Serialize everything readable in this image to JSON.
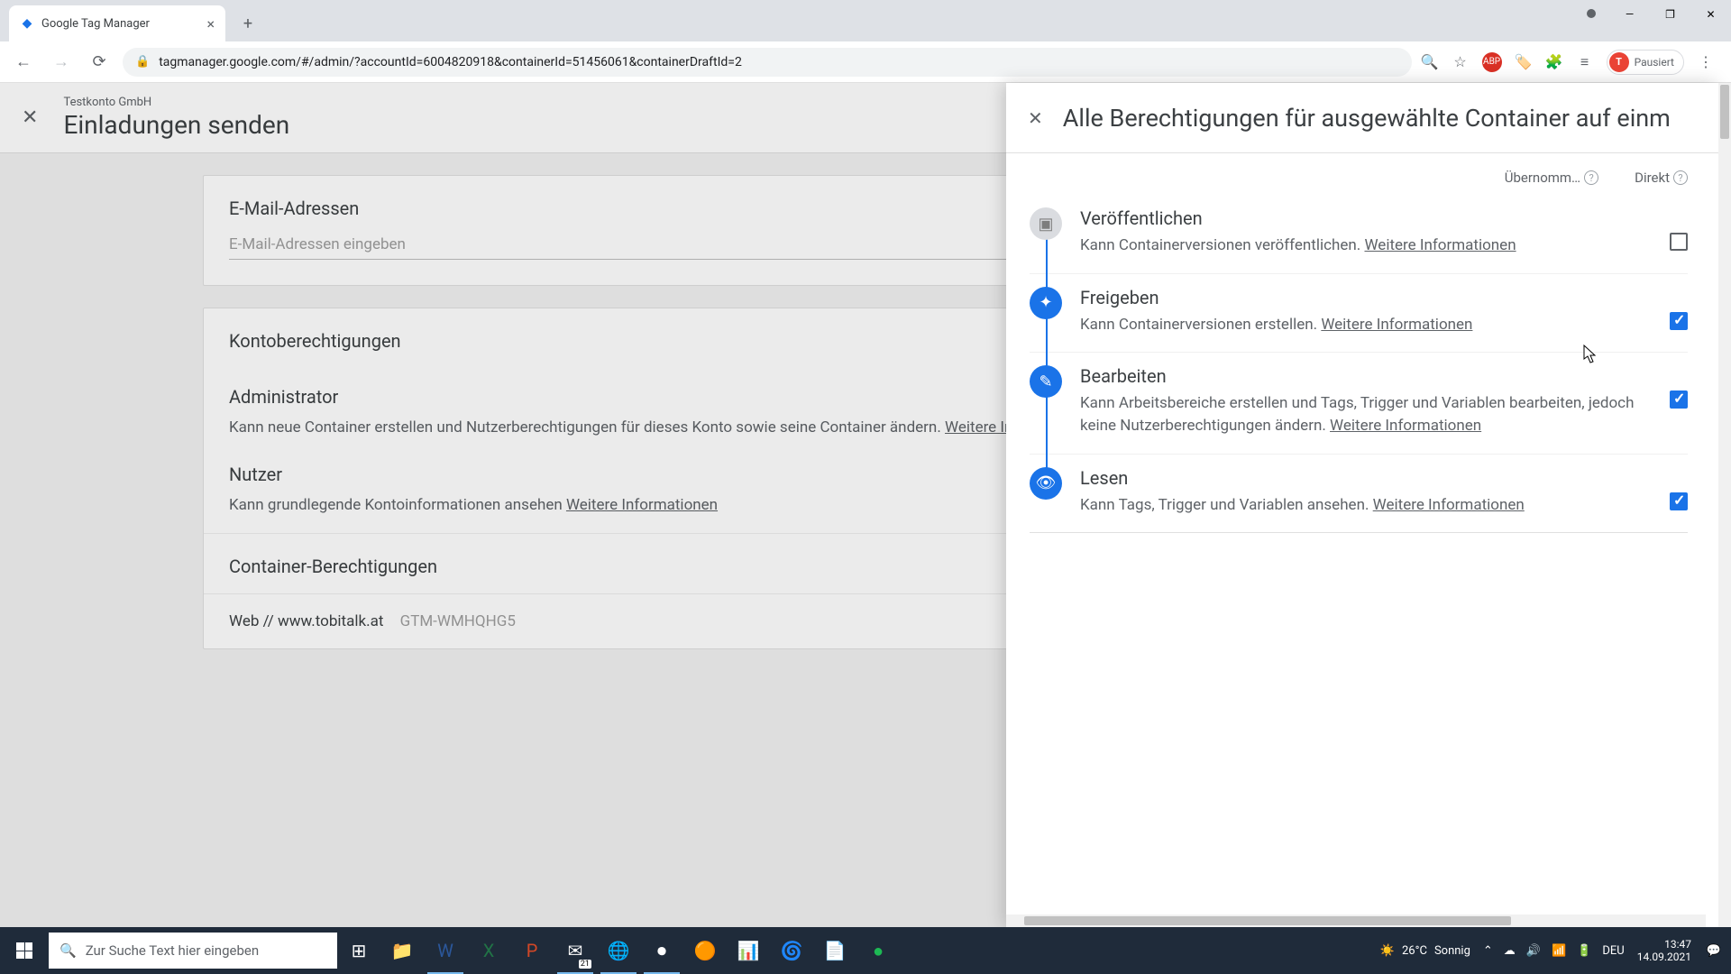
{
  "browser": {
    "tab_title": "Google Tag Manager",
    "url": "tagmanager.google.com/#/admin/?accountId=6004820918&containerId=51456061&containerDraftId=2",
    "profile_status": "Pausiert",
    "profile_initial": "T"
  },
  "main": {
    "account_name": "Testkonto GmbH",
    "page_title": "Einladungen senden",
    "email_section_title": "E-Mail-Adressen",
    "email_placeholder": "E-Mail-Adressen eingeben",
    "account_perm_title": "Kontoberechtigungen",
    "admin_title": "Administrator",
    "admin_desc": "Kann neue Container erstellen und Nutzerberechtigungen für dieses Konto sowie seine Container ändern. ",
    "more_info": "Weitere Informationen",
    "user_title": "Nutzer",
    "user_desc": "Kann grundlegende Kontoinformationen ansehen ",
    "container_perm_title": "Container-Berechtigungen",
    "container_name": "Web // www.tobitalk.at",
    "container_id": "GTM-WMHQHG5"
  },
  "panel": {
    "title": "Alle Berechtigungen für ausgewählte Container auf einm",
    "col_inherited": "Übernomm…",
    "col_direct": "Direkt",
    "perms": [
      {
        "title": "Veröffentlichen",
        "desc": "Kann Containerversionen veröffentlichen. ",
        "checked": false,
        "icon": "publish",
        "color": "grey"
      },
      {
        "title": "Freigeben",
        "desc": "Kann Containerversionen erstellen. ",
        "checked": true,
        "icon": "approve",
        "color": "blue"
      },
      {
        "title": "Bearbeiten",
        "desc": "Kann Arbeitsbereiche erstellen und Tags, Trigger und Variablen bearbeiten, jedoch keine Nutzerberechtigungen ändern. ",
        "checked": true,
        "icon": "edit",
        "color": "blue"
      },
      {
        "title": "Lesen",
        "desc": "Kann Tags, Trigger und Variablen ansehen. ",
        "checked": true,
        "icon": "view",
        "color": "blue"
      }
    ]
  },
  "taskbar": {
    "search_placeholder": "Zur Suche Text hier eingeben",
    "weather_temp": "26°C",
    "weather_text": "Sonnig",
    "lang": "DEU",
    "time": "13:47",
    "date": "14.09.2021",
    "calendar_badge": "21"
  }
}
